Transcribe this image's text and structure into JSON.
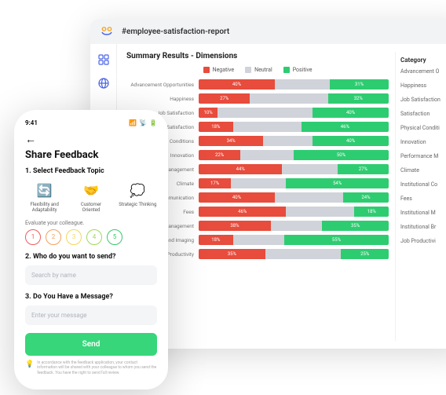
{
  "colors": {
    "negative": "#e74c3c",
    "neutral": "#d0d3d9",
    "positive": "#2ecc71"
  },
  "desktop": {
    "header_title": "#employee-satisfaction-report",
    "section_title": "Summary Results - Dimensions",
    "legend": {
      "neg": "Negative",
      "neu": "Neutral",
      "pos": "Positive"
    },
    "category_header": "Category",
    "categories": [
      "Advancement O",
      "Happiness",
      "Job Satisfaction",
      "Satisfaction",
      "Physical Conditi",
      "Innovation",
      "Performance M",
      "Climate",
      "Institutional Co",
      "Fees",
      "Institutional M",
      "Institutional Br",
      "Job Productivi"
    ]
  },
  "chart_data": {
    "type": "bar",
    "title": "Summary Results - Dimensions",
    "xlabel": "",
    "ylabel": "",
    "ylim": [
      0,
      100
    ],
    "stacked": true,
    "series_names": [
      "Negative",
      "Neutral",
      "Positive"
    ],
    "items": [
      {
        "label": "Advancement Opportunities",
        "neg": 40,
        "neu": 29,
        "pos": 31
      },
      {
        "label": "Happiness",
        "neg": 27,
        "neu": 41,
        "pos": 32
      },
      {
        "label": "Job Satisfaction",
        "neg": 10,
        "neu": 50,
        "pos": 40
      },
      {
        "label": "Satisfaction",
        "neg": 18,
        "neu": 36,
        "pos": 46
      },
      {
        "label": "Physical Conditions",
        "neg": 34,
        "neu": 26,
        "pos": 40
      },
      {
        "label": "Innovation",
        "neg": 22,
        "neu": 28,
        "pos": 50
      },
      {
        "label": "Performance Management",
        "neg": 44,
        "neu": 29,
        "pos": 27
      },
      {
        "label": "Climate",
        "neg": 17,
        "neu": 29,
        "pos": 54
      },
      {
        "label": "Institutional Communication",
        "neg": 40,
        "neu": 36,
        "pos": 24
      },
      {
        "label": "Fees",
        "neg": 46,
        "neu": 36,
        "pos": 18
      },
      {
        "label": "Institutional Management",
        "neg": 38,
        "neu": 27,
        "pos": 35
      },
      {
        "label": "Institutional Brand Imaging",
        "neg": 18,
        "neu": 27,
        "pos": 55
      },
      {
        "label": "Job Productivity",
        "neg": 35,
        "neu": 40,
        "pos": 25
      }
    ]
  },
  "phone": {
    "status_time": "9:41",
    "title": "Share Feedback",
    "section1": "1. Select Feedback Topic",
    "topics": [
      {
        "icon": "🔄",
        "label": "Flexibility and Adaptability"
      },
      {
        "icon": "🤝",
        "label": "Customer Oriented"
      },
      {
        "icon": "💭",
        "label": "Strategic Thinking"
      }
    ],
    "evaluate_label": "Evaluate your colleague.",
    "rating_colors": [
      "#f15b5b",
      "#f5a05b",
      "#f5d75b",
      "#9fd95b",
      "#3bc86b"
    ],
    "rating_values": [
      "1",
      "2",
      "3",
      "4",
      "5"
    ],
    "section2": "2. Who do you want to send?",
    "search_placeholder": "Search by name",
    "section3": "3. Do You Have a Message?",
    "message_placeholder": "Enter your message",
    "send_label": "Send",
    "disclaimer": "In accordance with the feedback application, your contact information will be shared with your colleague to whom you send the feedback. You have the right to send full review."
  }
}
